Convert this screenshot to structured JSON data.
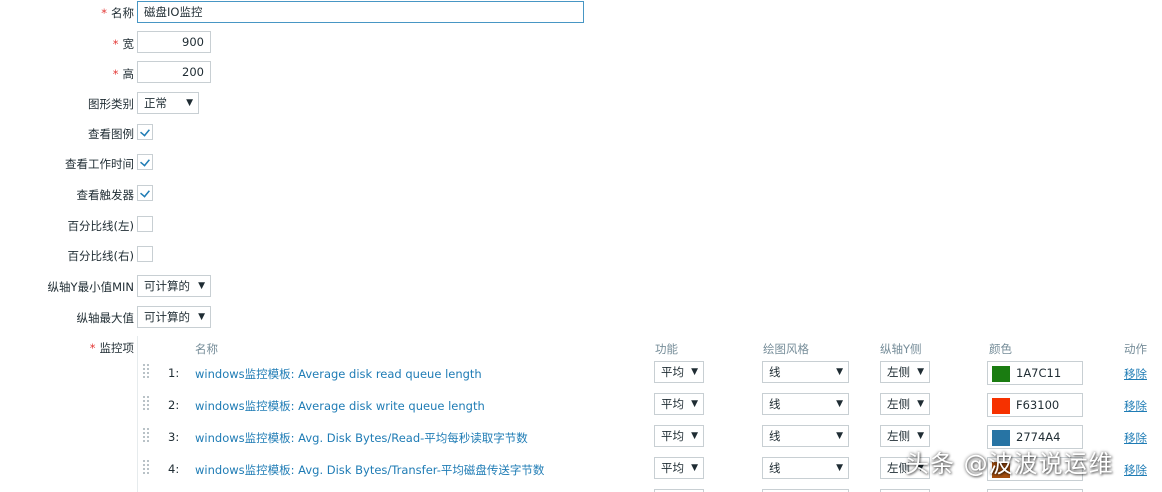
{
  "form": {
    "required_mark": "*",
    "name_label": "名称",
    "name_value": "磁盘IO监控",
    "width_label": "宽",
    "width_value": "900",
    "height_label": "高",
    "height_value": "200",
    "graph_type_label": "图形类别",
    "graph_type_value": "正常",
    "show_legend_label": "查看图例",
    "show_legend": true,
    "show_worktime_label": "查看工作时间",
    "show_worktime": true,
    "show_triggers_label": "查看触发器",
    "show_triggers": true,
    "percentile_left_label": "百分比线(左)",
    "percentile_left": false,
    "percentile_right_label": "百分比线(右)",
    "percentile_right": false,
    "ymin_label": "纵轴Y最小值MIN",
    "ymin_value": "可计算的",
    "ymax_label": "纵轴最大值",
    "ymax_value": "可计算的",
    "items_label": "监控项"
  },
  "items_table": {
    "headers": {
      "name": "名称",
      "function": "功能",
      "draw_style": "绘图风格",
      "y_axis_side": "纵轴Y侧",
      "color": "颜色",
      "action": "动作"
    },
    "rows": [
      {
        "index": "1:",
        "name": "windows监控模板: Average disk read queue length",
        "function": "平均",
        "draw_style": "线",
        "y_axis_side": "左侧",
        "color_hex": "1A7C11",
        "color": "#1A7C11",
        "action": "移除"
      },
      {
        "index": "2:",
        "name": "windows监控模板: Average disk write queue length",
        "function": "平均",
        "draw_style": "线",
        "y_axis_side": "左侧",
        "color_hex": "F63100",
        "color": "#F63100",
        "action": "移除"
      },
      {
        "index": "3:",
        "name": "windows监控模板: Avg. Disk Bytes/Read-平均每秒读取字节数",
        "function": "平均",
        "draw_style": "线",
        "y_axis_side": "左侧",
        "color_hex": "2774A4",
        "color": "#2774A4",
        "action": "移除"
      },
      {
        "index": "4:",
        "name": "windows监控模板: Avg. Disk Bytes/Transfer-平均磁盘传送字节数",
        "function": "平均",
        "draw_style": "线",
        "y_axis_side": "左侧",
        "color_hex": "",
        "color": "#A54F10",
        "action": "移除"
      }
    ]
  },
  "watermark": "头条 @波波说运维",
  "icons": {
    "select_caret": "caret-down-icon",
    "checkbox_check": "check-icon",
    "drag_handle": "drag-handle-icon"
  },
  "colors": {
    "link": "#1f7cb5",
    "required": "#e33734",
    "border": "#c8cfd3",
    "focus_border": "#4796c4"
  }
}
